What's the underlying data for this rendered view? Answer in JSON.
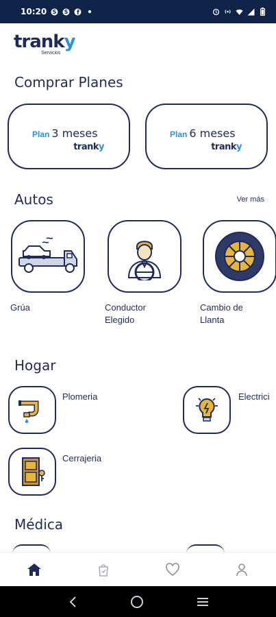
{
  "status_bar": {
    "time": "10:20",
    "left_icons": [
      "skype-icon",
      "skype-icon",
      "facebook-icon",
      "dot-icon"
    ],
    "right_icons": [
      "alarm-icon",
      "hotspot-icon",
      "wifi-icon",
      "signal-icon",
      "battery-icon"
    ]
  },
  "brand": {
    "logo_text": "tranky",
    "logo_sub": "Servicios"
  },
  "plans": {
    "title": "Comprar Planes",
    "items": [
      {
        "prefix": "Plan",
        "label": "3 meses",
        "brand": "tranky"
      },
      {
        "prefix": "Plan",
        "label": "6 meses",
        "brand": "tranky"
      }
    ]
  },
  "autos": {
    "title": "Autos",
    "see_more": "Ver más",
    "items": [
      {
        "label": "Grúa",
        "icon": "tow-truck-icon"
      },
      {
        "label": "Conductor Elegido",
        "icon": "driver-icon"
      },
      {
        "label": "Cambio de Llanta",
        "icon": "tire-icon"
      }
    ]
  },
  "hogar": {
    "title": "Hogar",
    "items": [
      {
        "label": "Plomeria",
        "icon": "plumbing-icon"
      },
      {
        "label": "Electrici",
        "icon": "lightbulb-icon"
      },
      {
        "label": "Cerrajeria",
        "icon": "door-lock-icon"
      }
    ]
  },
  "medica": {
    "title": "Médica"
  },
  "bottom_nav": [
    "home-icon",
    "shopping-bag-icon",
    "heart-icon",
    "profile-icon"
  ],
  "colors": {
    "brand_navy": "#1e2a5a",
    "brand_blue": "#2a93d5",
    "status_bar": "#0f2247",
    "accent_yellow": "#e7b53a"
  }
}
